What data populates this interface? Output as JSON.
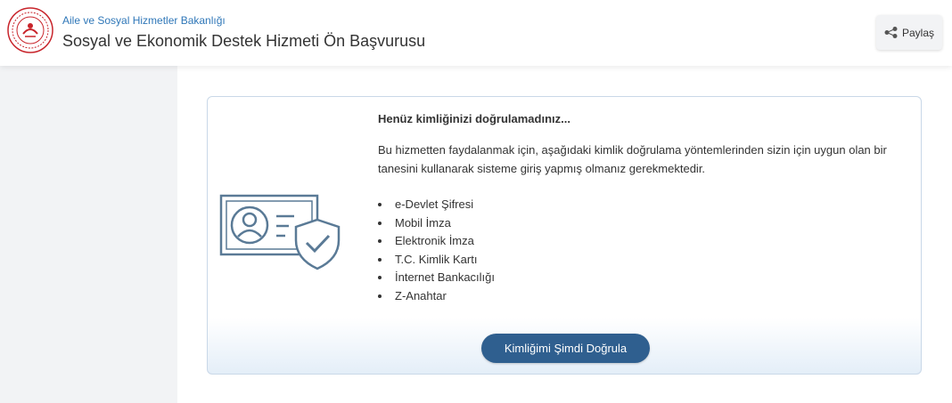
{
  "header": {
    "ministry": "Aile ve Sosyal Hizmetler Bakanlığı",
    "service_title": "Sosyal ve Ekonomik Destek Hizmeti Ön Başvurusu",
    "share_label": "Paylaş",
    "icons": {
      "logo": "ministry-seal",
      "share": "share-icon"
    }
  },
  "notice": {
    "title": "Henüz kimliğinizi doğrulamadınız...",
    "description": "Bu hizmetten faydalanmak için, aşağıdaki kimlik doğrulama yöntemlerinden sizin için uygun olan bir tanesini kullanarak sisteme giriş yapmış olmanız gerekmektedir.",
    "methods": [
      "e-Devlet Şifresi",
      "Mobil İmza",
      "Elektronik İmza",
      "T.C. Kimlik Kartı",
      "İnternet Bankacılığı",
      "Z-Anahtar"
    ],
    "verify_button": "Kimliğimi Şimdi Doğrula",
    "illustration": "id-card-shield-icon"
  },
  "colors": {
    "primary": "#2f5f8f",
    "link": "#2f77b8",
    "logo_red": "#c8242b",
    "illustration": "#5a7a96"
  }
}
